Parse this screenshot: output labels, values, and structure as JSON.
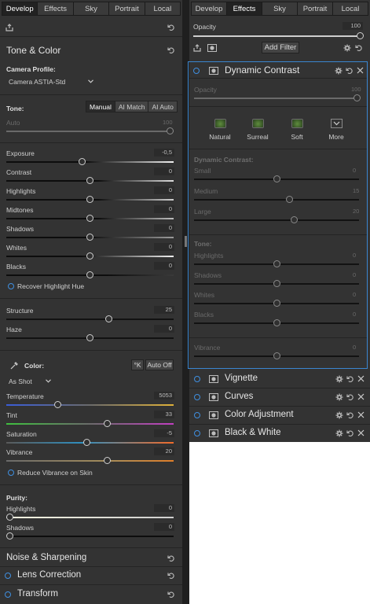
{
  "tabs": [
    "Develop",
    "Effects",
    "Sky",
    "Portrait",
    "Local"
  ],
  "left": {
    "active_tab": "Develop",
    "section_title": "Tone & Color",
    "camera_profile_label": "Camera Profile:",
    "camera_profile_value": "Camera ASTIA-Std",
    "tone_label": "Tone:",
    "tone_modes": [
      "Manual",
      "AI Match",
      "AI Auto"
    ],
    "auto_label": "Auto",
    "auto_value": "100",
    "sliders": [
      {
        "label": "Exposure",
        "value": "-0,5",
        "pos": 0.45
      },
      {
        "label": "Contrast",
        "value": "0",
        "pos": 0.5
      },
      {
        "label": "Highlights",
        "value": "0",
        "pos": 0.5
      },
      {
        "label": "Midtones",
        "value": "0",
        "pos": 0.5
      },
      {
        "label": "Shadows",
        "value": "0",
        "pos": 0.5
      },
      {
        "label": "Whites",
        "value": "0",
        "pos": 0.5
      },
      {
        "label": "Blacks",
        "value": "0",
        "pos": 0.5
      }
    ],
    "recover_highlight_hue": "Recover Highlight Hue",
    "structure": {
      "label": "Structure",
      "value": "25",
      "pos": 0.62
    },
    "haze": {
      "label": "Haze",
      "value": "0",
      "pos": 0.5
    },
    "color_label": "Color:",
    "kelvin_button": "°K",
    "auto_off_button": "Auto Off",
    "white_balance": "As Shot",
    "temperature": {
      "label": "Temperature",
      "value": "5053",
      "pos": 0.3
    },
    "tint": {
      "label": "Tint",
      "value": "33",
      "pos": 0.61
    },
    "saturation": {
      "label": "Saturation",
      "value": "-5",
      "pos": 0.48
    },
    "vibrance": {
      "label": "Vibrance",
      "value": "20",
      "pos": 0.61
    },
    "reduce_vibrance": "Reduce Vibrance on Skin",
    "purity_label": "Purity:",
    "purity_highlights": {
      "label": "Highlights",
      "value": "0",
      "pos": 0.0
    },
    "purity_shadows": {
      "label": "Shadows",
      "value": "0",
      "pos": 0.0
    },
    "bottom_sections": [
      "Noise & Sharpening",
      "Lens Correction",
      "Transform"
    ]
  },
  "right": {
    "active_tab": "Effects",
    "opacity_label": "Opacity",
    "opacity_value": "100",
    "add_filter": "Add Filter",
    "filter_title": "Dynamic Contrast",
    "inner_opacity_label": "Opacity",
    "inner_opacity_value": "100",
    "presets": [
      "Natural",
      "Surreal",
      "Soft",
      "More"
    ],
    "dc_label": "Dynamic Contrast:",
    "dc_sliders": [
      {
        "label": "Small",
        "value": "0",
        "pos": 0.5
      },
      {
        "label": "Medium",
        "value": "15",
        "pos": 0.58
      },
      {
        "label": "Large",
        "value": "20",
        "pos": 0.61
      }
    ],
    "tone_label": "Tone:",
    "tone_sliders": [
      {
        "label": "Highlights",
        "value": "0",
        "pos": 0.5
      },
      {
        "label": "Shadows",
        "value": "0",
        "pos": 0.5
      },
      {
        "label": "Whites",
        "value": "0",
        "pos": 0.5
      },
      {
        "label": "Blacks",
        "value": "0",
        "pos": 0.5
      }
    ],
    "vibrance": {
      "label": "Vibrance",
      "value": "0",
      "pos": 0.5
    },
    "filters": [
      "Vignette",
      "Curves",
      "Color Adjustment",
      "Black & White"
    ]
  }
}
